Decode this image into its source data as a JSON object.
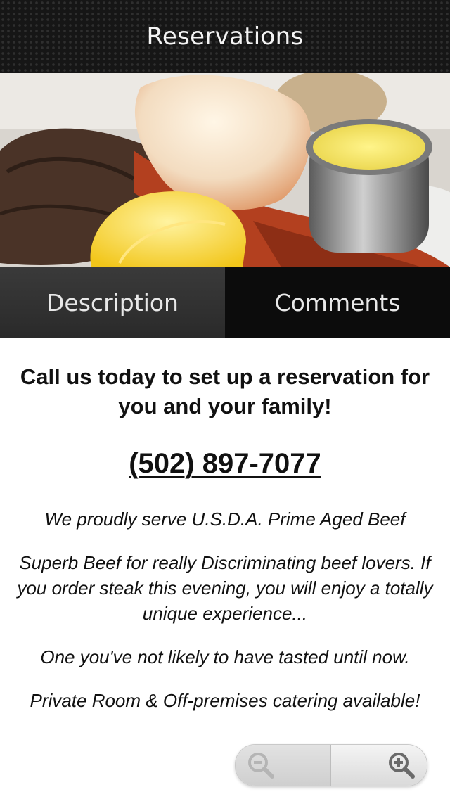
{
  "header": {
    "title": "Reservations"
  },
  "hero": {
    "image_subject": "steak-and-lobster-plate"
  },
  "tabs": [
    {
      "label": "Description",
      "active": true
    },
    {
      "label": "Comments",
      "active": false
    }
  ],
  "content": {
    "headline": "Call us today to set up a reservation for you and your family!",
    "phone": "(502) 897-7077",
    "paragraphs": [
      "We proudly serve U.S.D.A. Prime Aged Beef",
      "Superb Beef for really Discriminating beef lovers. If you order steak this evening, you will enjoy a totally unique experience...",
      "One you've not likely to have tasted until now.",
      "Private Room & Off-premises catering available!"
    ]
  },
  "zoom_controls": {
    "zoom_out_icon": "zoom-out-icon",
    "zoom_in_icon": "zoom-in-icon",
    "zoom_out_enabled": false
  }
}
